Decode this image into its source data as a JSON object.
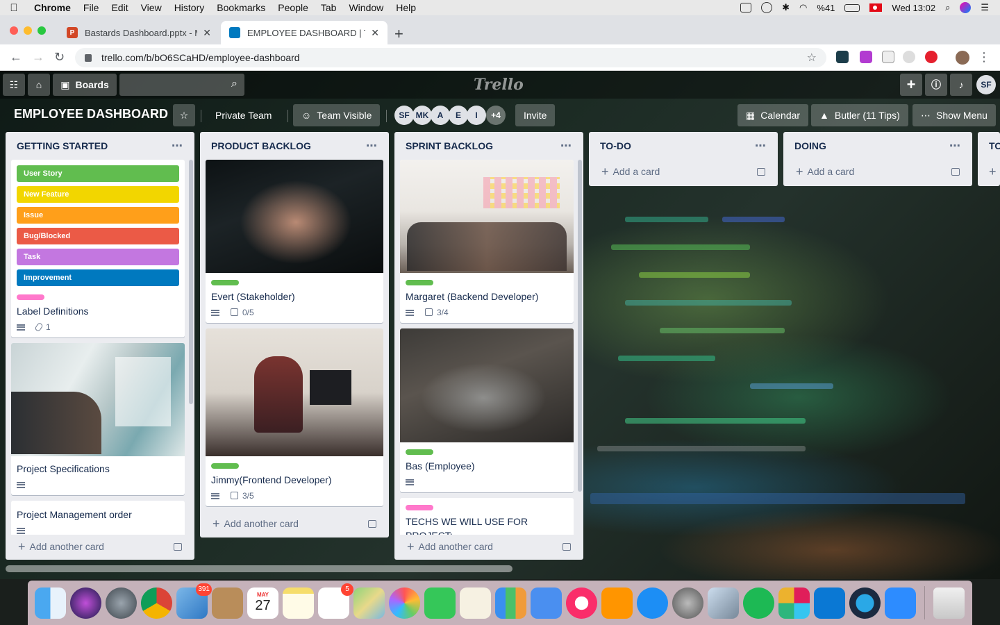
{
  "menubar": {
    "app": "Chrome",
    "items": [
      "File",
      "Edit",
      "View",
      "History",
      "Bookmarks",
      "People",
      "Tab",
      "Window",
      "Help"
    ],
    "battery": "%41",
    "clock": "Wed 13:02"
  },
  "tabs": [
    {
      "title": "Bastards Dashboard.pptx - Mic",
      "fav_color": "#d24726",
      "fav_letter": "P"
    },
    {
      "title": "EMPLOYEE DASHBOARD | Trell",
      "fav_color": "#0079bf",
      "fav_letter": ""
    }
  ],
  "address": {
    "url": "trello.com/b/bO6SCaHD/employee-dashboard"
  },
  "trello_header": {
    "boards_label": "Boards",
    "logo": "Trello",
    "user_initials": "SF"
  },
  "board": {
    "title": "EMPLOYEE DASHBOARD",
    "team": "Private Team",
    "visibility": "Team Visible",
    "members": [
      "SF",
      "MK",
      "A",
      "E",
      "I"
    ],
    "more_members": "+4",
    "invite": "Invite",
    "calendar": "Calendar",
    "butler": "Butler (11 Tips)",
    "show_menu": "Show Menu"
  },
  "label_colors": [
    "#61bd4f",
    "#f2d600",
    "#ff9f1a",
    "#eb5a46",
    "#c377e0",
    "#0079bf"
  ],
  "lists": {
    "getting_started": {
      "title": "GETTING STARTED",
      "labels": [
        "User Story",
        "New Feature",
        "Issue",
        "Bug/Blocked",
        "Task",
        "Improvement"
      ],
      "label_def_title": "Label Definitions",
      "label_def_attachments": "1",
      "card2_title": "Project Specifications",
      "card3_title": "Project Management order",
      "add": "Add another card"
    },
    "product_backlog": {
      "title": "PRODUCT BACKLOG",
      "card1_title": "Evert (Stakeholder)",
      "card1_check": "0/5",
      "card2_title": "Jimmy(Frontend Developer)",
      "card2_check": "3/5",
      "add": "Add another card"
    },
    "sprint_backlog": {
      "title": "SPRINT BACKLOG",
      "card1_title": "Margaret (Backend Developer)",
      "card1_check": "3/4",
      "card2_title": "Bas (Employee)",
      "card3_title": "TECHS WE WILL USE FOR PROJECT:",
      "add": "Add another card"
    },
    "todo": {
      "title": "TO-DO",
      "add": "Add a card"
    },
    "doing": {
      "title": "DOING",
      "add": "Add a card"
    },
    "partial": {
      "title": "TO"
    }
  },
  "dock": {
    "mail_badge": "391",
    "reminders_badge": "5",
    "calendar_month": "MAY",
    "calendar_day": "27"
  }
}
